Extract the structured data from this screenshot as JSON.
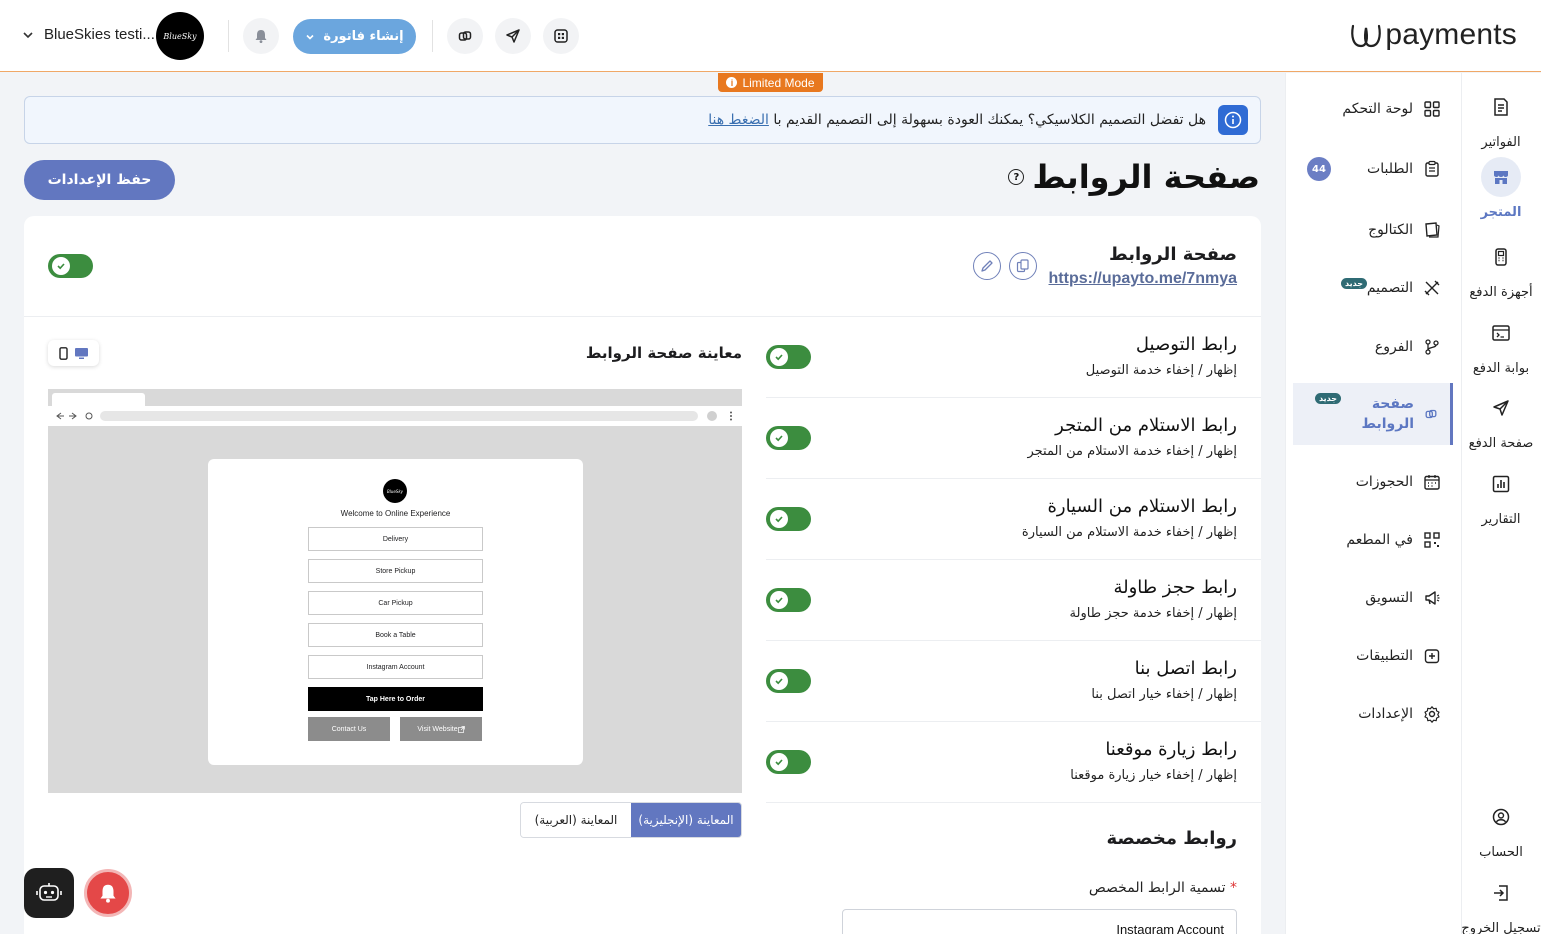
{
  "header": {
    "logo_text": "payments",
    "account_name": "BlueSkies testi...",
    "avatar_text": "BlueSky",
    "create_invoice_label": "إنشاء فاتورة",
    "limited_mode": "Limited Mode"
  },
  "rail": {
    "items": [
      {
        "label": "الفواتير",
        "icon": "invoice-icon"
      },
      {
        "label": "المتجر",
        "icon": "store-icon",
        "active": true
      },
      {
        "label": "أجهزة الدفع",
        "icon": "pos-device-icon"
      },
      {
        "label": "بوابة الدفع",
        "icon": "payment-gateway-icon"
      },
      {
        "label": "صفحة الدفع",
        "icon": "send-icon"
      },
      {
        "label": "التقارير",
        "icon": "reports-icon"
      }
    ],
    "bottom": [
      {
        "label": "الحساب",
        "icon": "account-icon"
      },
      {
        "label": "تسجيل الخروج",
        "icon": "logout-icon"
      }
    ]
  },
  "menu": {
    "items": [
      {
        "label": "لوحة التحكم",
        "icon": "dashboard-icon"
      },
      {
        "label": "الطلبات",
        "icon": "orders-icon",
        "count": "44"
      },
      {
        "label": "الكتالوج",
        "icon": "catalog-icon"
      },
      {
        "label": "التصميم",
        "icon": "design-icon",
        "badge": "جديد"
      },
      {
        "label": "الفروع",
        "icon": "branches-icon"
      },
      {
        "label": "صفحة الروابط",
        "icon": "links-icon",
        "badge": "جديد",
        "active": true
      },
      {
        "label": "الحجوزات",
        "icon": "bookings-icon"
      },
      {
        "label": "في المطعم",
        "icon": "qr-icon"
      },
      {
        "label": "التسويق",
        "icon": "marketing-icon"
      },
      {
        "label": "التطبيقات",
        "icon": "apps-icon"
      },
      {
        "label": "الإعدادات",
        "icon": "settings-icon"
      }
    ]
  },
  "banner": {
    "text": "هل تفضل التصميم الكلاسيكي؟ يمكنك العودة بسهولة إلى التصميم القديم با",
    "link": "الضغط هنا"
  },
  "page": {
    "title": "صفحة الروابط",
    "save_label": "حفظ الإعدادات",
    "link_page_name": "صفحة الروابط",
    "link_page_url": "https://upayto.me/7nmya",
    "enabled": true
  },
  "options": [
    {
      "title": "رابط التوصيل",
      "subtitle": "إظهار / إخفاء خدمة التوصيل",
      "enabled": true
    },
    {
      "title": "رابط الاستلام من المتجر",
      "subtitle": "إظهار / إخفاء خدمة الاستلام من المتجر",
      "enabled": true
    },
    {
      "title": "رابط الاستلام من السيارة",
      "subtitle": "إظهار / إخفاء خدمة الاستلام من السيارة",
      "enabled": true
    },
    {
      "title": "رابط حجز طاولة",
      "subtitle": "إظهار / إخفاء خدمة حجز طاولة",
      "enabled": true
    },
    {
      "title": "رابط اتصل بنا",
      "subtitle": "إظهار / إخفاء خيار اتصل بنا",
      "enabled": true
    },
    {
      "title": "رابط زيارة موقعنا",
      "subtitle": "إظهار / إخفاء خيار زيارة موقعنا",
      "enabled": true
    }
  ],
  "custom": {
    "title": "روابط مخصصة",
    "field_label": "تسمية الرابط المخصص",
    "required_mark": "*",
    "field_value": "Instagram Account"
  },
  "preview": {
    "title": "معاينة صفحة الروابط",
    "logo_text": "BlueSky",
    "welcome": "Welcome to Online Experience",
    "buttons": [
      "Delivery",
      "Store Pickup",
      "Car Pickup",
      "Book a Table",
      "Instagram Account"
    ],
    "order_button": "Tap Here to Order",
    "contact_button": "Contact Us",
    "website_button": "Visit Website",
    "tab_english": "المعاينة (الإنجليزية)",
    "tab_arabic": "المعاينة (العربية)"
  },
  "colors": {
    "accent": "#6277c0",
    "toggle_on": "#3c8d3f",
    "limited": "#e8781f",
    "invoice_button": "#6ba6de"
  }
}
